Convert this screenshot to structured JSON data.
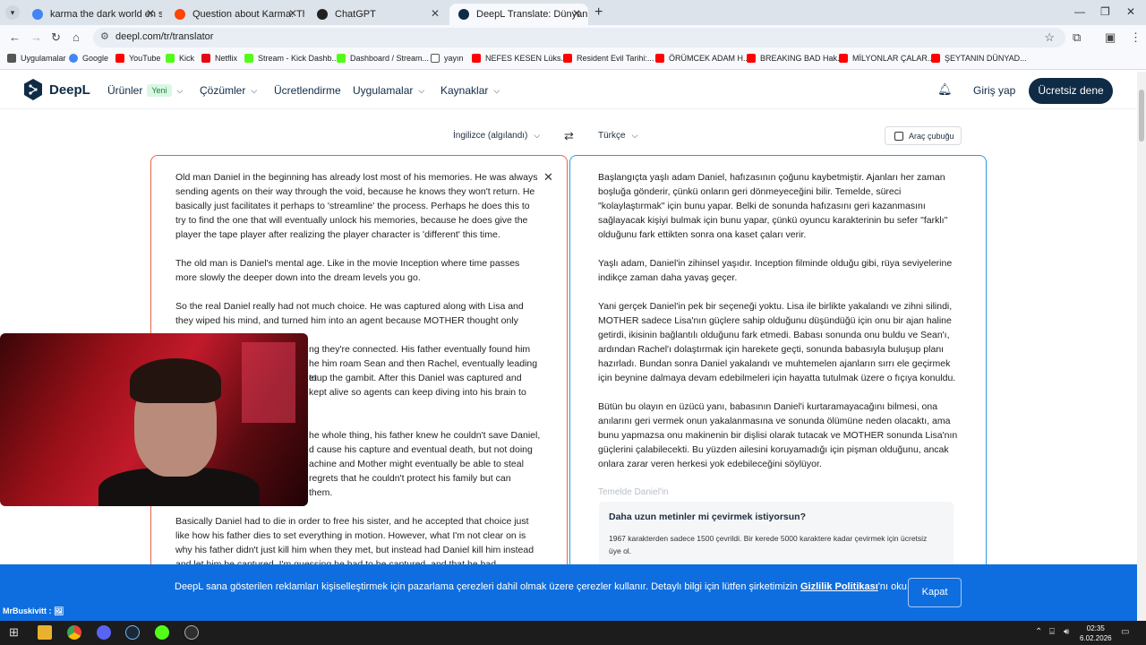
{
  "browser": {
    "tabs": [
      {
        "title": "karma the dark world en sonun",
        "favicon_color": "#4285f4"
      },
      {
        "title": "Question about Karma: The Da",
        "favicon_color": "#ff4500"
      },
      {
        "title": "ChatGPT",
        "favicon_color": "#222222"
      },
      {
        "title": "DeepL Translate: Dünyanın en i",
        "favicon_color": "#0f2b46"
      }
    ],
    "url": "deepl.com/tr/translator",
    "bookmarks": [
      {
        "label": "Uygulamalar",
        "icon_color": "#555555"
      },
      {
        "label": "Google",
        "icon_color": "#4285f4"
      },
      {
        "label": "YouTube",
        "icon_color": "#ff0000"
      },
      {
        "label": "Kick",
        "icon_color": "#53fc18"
      },
      {
        "label": "Netflix",
        "icon_color": "#e50914"
      },
      {
        "label": "Stream - Kick Dashb...",
        "icon_color": "#53fc18"
      },
      {
        "label": "Dashboard / Stream...",
        "icon_color": "#53fc18"
      },
      {
        "label": "yayın",
        "icon_color": "#777777"
      },
      {
        "label": "NEFES KESEN Lüks...",
        "icon_color": "#ff0000"
      },
      {
        "label": "Resident Evil Tarihi:...",
        "icon_color": "#ff0000"
      },
      {
        "label": "ÖRÜMCEK ADAM H...",
        "icon_color": "#ff0000"
      },
      {
        "label": "BREAKING BAD Hak...",
        "icon_color": "#ff0000"
      },
      {
        "label": "MİLYONLAR ÇALAR...",
        "icon_color": "#ff0000"
      },
      {
        "label": "ŞEYTANIN DÜNYAD...",
        "icon_color": "#ff0000"
      }
    ]
  },
  "deepl_header": {
    "logo_text": "DeepL",
    "nav": [
      {
        "label": "Ürünler",
        "badge": "Yeni",
        "has_chevron": true
      },
      {
        "label": "Çözümler",
        "has_chevron": true
      },
      {
        "label": "Ücretlendirme",
        "has_chevron": false
      },
      {
        "label": "Uygulamalar",
        "has_chevron": true
      },
      {
        "label": "Kaynaklar",
        "has_chevron": true
      }
    ],
    "login_label": "Giriş yap",
    "cta_label": "Ücretsiz dene"
  },
  "translator": {
    "source_lang": "İngilizce (algılandı)",
    "target_lang": "Türkçe",
    "toolbar_label": "Araç çubuğu",
    "source_paragraphs": [
      "Old man Daniel in the beginning has already lost most of his memories. He was always sending agents on their way through the void, because he knows they won't return. He basically just facilitates it perhaps to 'streamline' the process. Perhaps he does this to try to find the one that will eventually unlock his memories, because he does give the player the tape player after realizing the player character is 'different' this time.",
      "The old man is Daniel's mental age. Like in the movie Inception where time passes more slowly the deeper down into the dream levels you go.",
      "So the real Daniel really had not much choice. He was captured along with Lisa and they wiped his mind, and turned him into an agent because MOTHER thought only",
      "ng they're connected. His father eventually found him",
      "he him roam Sean and then Rachel, eventually leading to",
      "etup the gambit. After this Daniel was captured and",
      "kept alive so agents can keep diving into his brain to",
      "he whole thing, his father knew he couldn't save Daniel,",
      "d cause his capture and eventual death, but not doing",
      "achine and Mother might eventually be able to steal",
      "regrets that he couldn't protect his family but can",
      "them.",
      "Basically Daniel had to die in order to free his sister, and he accepted that choice just like how his father dies to set everything in motion. However, what I'm not clear on is why his father didn't just kill him when they met, but instead had Daniel kill him instead and let him be captured. I'm guessing he had to be captured, and that he had"
    ],
    "target_paragraphs": [
      "Başlangıçta yaşlı adam Daniel, hafızasının çoğunu kaybetmiştir. Ajanları her zaman boşluğa gönderir, çünkü onların geri dönmeyeceğini bilir. Temelde, süreci \"kolaylaştırmak\" için bunu yapar. Belki de sonunda hafızasını geri kazanmasını sağlayacak kişiyi bulmak için bunu yapar, çünkü oyuncu karakterinin bu sefer \"farklı\" olduğunu fark ettikten sonra ona kaset çaları verir.",
      "Yaşlı adam, Daniel'in zihinsel yaşıdır. Inception filminde olduğu gibi, rüya seviyelerine indikçe zaman daha yavaş geçer.",
      "Yani gerçek Daniel'in pek bir seçeneği yoktu. Lisa ile birlikte yakalandı ve zihni silindi, MOTHER sadece Lisa'nın güçlere sahip olduğunu düşündüğü için onu bir ajan haline getirdi, ikisinin bağlantılı olduğunu fark etmedi. Babası sonunda onu buldu ve Sean'ı, ardından Rachel'ı dolaştırmak için harekete geçti, sonunda babasıyla buluşup planı hazırladı. Bundan sonra Daniel yakalandı ve muhtemelen ajanların sırrı ele geçirmek için beynine dalmaya devam edebilmeleri için hayatta tutulmak üzere o fıçıya konuldu.",
      "Bütün bu olayın en üzücü yanı, babasının Daniel'i kurtaramayacağını bilmesi, ona anılarını geri vermek onun yakalanmasına ve sonunda ölümüne neden olacaktı, ama bunu yapmazsa onu makinenin bir dişlisi olarak tutacak ve MOTHER sonunda Lisa'nın güçlerini çalabilecekti. Bu yüzden ailesini koruyamadığı için pişman olduğunu, ancak onlara zarar veren herkesi yok edebileceğini söylüyor."
    ],
    "target_faded": "Temelde Daniel'in",
    "promo_title": "Daha uzun metinler mi çevirmek istiyorsun?",
    "promo_body": "1967 karakterden sadece 1500 çevrildi. Bir kerede 5000 karaktere kadar çevirmek için ücretsiz üye ol."
  },
  "cookie_banner": {
    "message_before": "DeepL sana gösterilen reklamları kişiselleştirmek için pazarlama çerezleri dahil olmak üzere çerezler kullanır. Detaylı bilgi için lütfen şirketimizin ",
    "link": "Gizlilik Politikası",
    "message_after": "'nı oku.",
    "close_label": "Kapat"
  },
  "chat_overlay": "MrBuskivitt :",
  "taskbar": {
    "time": "02:35",
    "date": "6.02.2026"
  },
  "colors": {
    "deepl_navy": "#0f2b46",
    "source_border": "#e8614a",
    "target_border": "#2c9adf",
    "cookie_blue": "#0e6ee0"
  }
}
